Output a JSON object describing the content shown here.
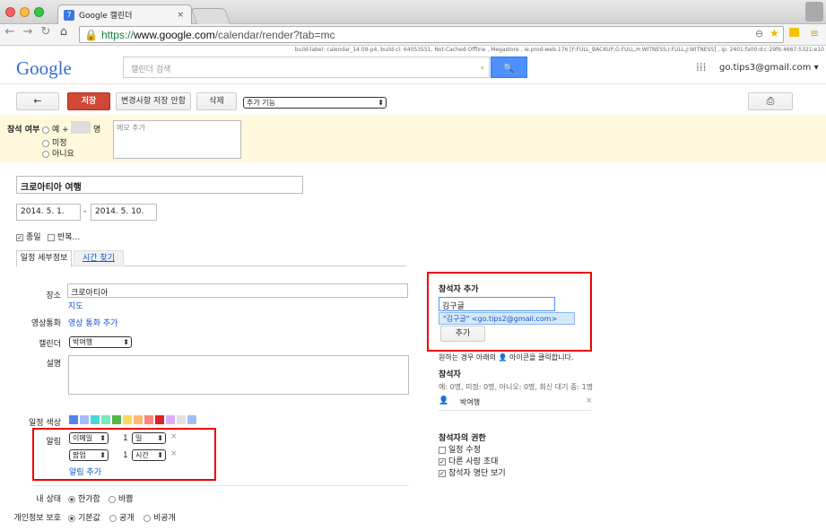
{
  "browser": {
    "tab_title": "Google 캘린더",
    "tab_close": "×",
    "url_scheme": "https://",
    "url_host": "www.google.com",
    "url_path": "/calendar/render?tab=mc",
    "build_label": "build-label: calendar_14.09-p4, build-cl: 64053551, Not-Cached-Offline , Megastore , ie.prod-web.176 [F:FULL_BACKUP,G:FULL,H:WITNESS,I:FULL,J:WITNESS] , ip: 2401:fa00:d:c:29f6:4667:5321:e10"
  },
  "header": {
    "logo": "Google",
    "search_placeholder": "캘린더 검색",
    "search_icon": "🔍",
    "account": "go.tips3@gmail.com ▾"
  },
  "actions": {
    "back": "←",
    "save": "저장",
    "discard": "변경사항 저장 안함",
    "delete": "삭제",
    "more": "추가 기능",
    "print": "⎙"
  },
  "rsvp": {
    "label": "참석 여부",
    "yes": "예 +",
    "guests_unit": "명",
    "maybe": "미정",
    "no": "아니요",
    "memo_placeholder": "메모 추가"
  },
  "event": {
    "title": "크로아티아 여행",
    "start_date": "2014. 5. 1.",
    "dash": "-",
    "end_date": "2014. 5. 10.",
    "all_day": "종일",
    "repeat": "반복..."
  },
  "tabs": {
    "details": "일정 세부정보",
    "find_time": "시간 찾기"
  },
  "details": {
    "where_label": "장소",
    "where_value": "크로아티아",
    "map_link": "지도",
    "video_label": "영상통화",
    "video_link": "영상 통화 추가",
    "calendar_label": "캘린더",
    "calendar_value": "박여행",
    "desc_label": "설명",
    "color_label": "일정 색상",
    "colors": [
      "#5484ed",
      "#a4bdfc",
      "#46d6db",
      "#7ae7bf",
      "#51b749",
      "#fbd75b",
      "#ffb878",
      "#ff887c",
      "#dc2127",
      "#dbadff",
      "#e1e1e1",
      "#a4bdfc"
    ],
    "reminder_label": "알림",
    "reminders": [
      {
        "method": "이메일",
        "value": "1",
        "unit": "일"
      },
      {
        "method": "팝업",
        "value": "1",
        "unit": "시간"
      }
    ],
    "add_reminder": "알림 추가",
    "status_label": "내 상태",
    "status_free": "한가함",
    "status_busy": "바쁨",
    "privacy_label": "개인정보 보호",
    "privacy_default": "기본값",
    "privacy_public": "공개",
    "privacy_private": "비공개"
  },
  "guests": {
    "add_title": "참석자 추가",
    "input_value": "김구글",
    "suggestion": "\"김구글\" <go.tips2@gmail.com>",
    "add_button": "추가",
    "hint": "원하는 경우 아래의 👤 아이콘을 클릭합니다.",
    "title": "참석자",
    "counts": "예: 0명, 미정: 0명, 아니오: 0명, 회신 대기 중: 1명",
    "guest_name": "박여행",
    "remove": "×",
    "perm_title": "참석자의 권한",
    "perm_modify": "일정 수정",
    "perm_invite": "다른 사람 초대",
    "perm_see": "참석자 명단 보기"
  }
}
